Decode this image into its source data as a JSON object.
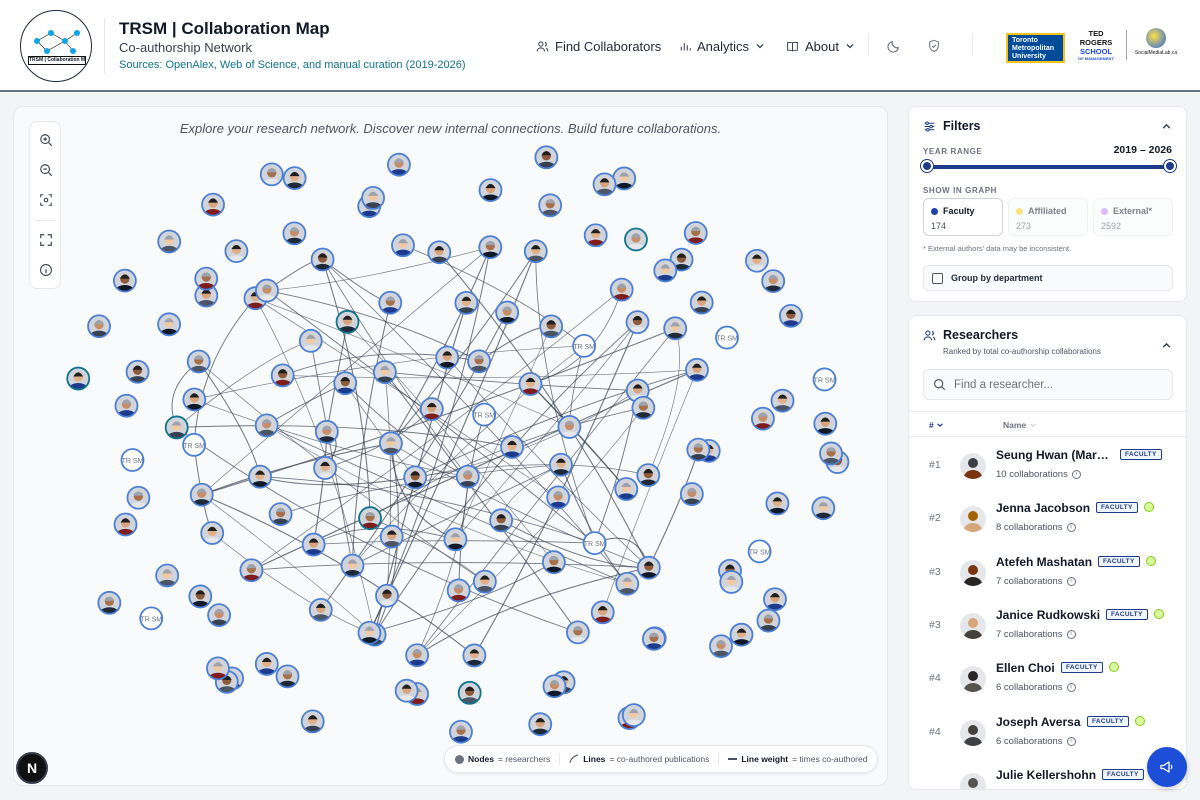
{
  "header": {
    "title": "TRSM | Collaboration Map",
    "subtitle": "Co-authorship Network",
    "sources": "Sources: OpenAlex, Web of Science, and manual curation (2019-2026)",
    "logo_caption": "TRSM | Collaboration Map",
    "nav": {
      "find": "Find Collaborators",
      "analytics": "Analytics",
      "about": "About"
    },
    "partner_logos": {
      "tmu": "Toronto Metropolitan University",
      "trs_line1": "TED",
      "trs_line2": "ROGERS",
      "trs_line3": "SCHOOL",
      "trs_line4": "OF MANAGEMENT",
      "smlab": "SocialMediaLab.ca"
    }
  },
  "graph": {
    "tagline": "Explore your research network. Discover new internal connections. Build future collaborations.",
    "node_label": "TR SM",
    "legend": {
      "nodes_key": "Nodes",
      "nodes_desc": "= researchers",
      "lines_key": "Lines",
      "lines_desc": "= co-authored publications",
      "weight_key": "Line weight",
      "weight_desc": "= times co-authored"
    }
  },
  "filters": {
    "title": "Filters",
    "year_range_label": "YEAR RANGE",
    "year_range_value": "2019 – 2026",
    "show_label": "SHOW IN GRAPH",
    "chips": [
      {
        "label": "Faculty",
        "count": "174",
        "color": "#1e40af"
      },
      {
        "label": "Affiliated",
        "count": "273",
        "color": "#facc15"
      },
      {
        "label": "External*",
        "count": "2592",
        "color": "#c084fc"
      }
    ],
    "external_note": "* External authors' data may be inconsistent.",
    "group_label": "Group by department"
  },
  "researchers": {
    "title": "Researchers",
    "subtitle": "Ranked by total co-authorship collaborations",
    "search_placeholder": "Find a researcher...",
    "col_rank": "#",
    "col_name": "Name",
    "rows": [
      {
        "rank": "#1",
        "name": "Seung Hwan (Mark)...",
        "badge": "FACULTY",
        "count": "10 collaborations"
      },
      {
        "rank": "#2",
        "name": "Jenna Jacobson",
        "badge": "FACULTY",
        "count": "8 collaborations"
      },
      {
        "rank": "#3",
        "name": "Atefeh Mashatan",
        "badge": "FACULTY",
        "count": "7 collaborations"
      },
      {
        "rank": "#3",
        "name": "Janice Rudkowski",
        "badge": "FACULTY",
        "count": "7 collaborations"
      },
      {
        "rank": "#4",
        "name": "Ellen Choi",
        "badge": "FACULTY",
        "count": "6 collaborations"
      },
      {
        "rank": "#4",
        "name": "Joseph Aversa",
        "badge": "FACULTY",
        "count": "6 collaborations"
      },
      {
        "rank": "",
        "name": "Julie Kellershohn",
        "badge": "FACULTY",
        "count": ""
      }
    ]
  },
  "footer": {
    "next_badge": "N"
  },
  "colors": {
    "brand_navy": "#1e3a8a",
    "node_border": "#4a7fd6",
    "link_accent": "#0e7490"
  }
}
